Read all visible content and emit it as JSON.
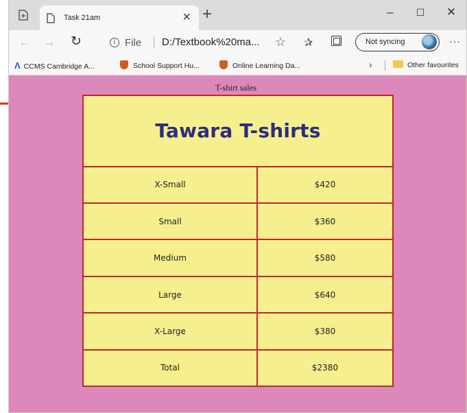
{
  "browser": {
    "tab_title": "Task 21am",
    "tab_close": "×",
    "new_tab": "+",
    "window_controls": {
      "minimize": "–",
      "maximize": "☐",
      "close": "✕"
    },
    "nav": {
      "back": "←",
      "forward": "→",
      "refresh": "↻"
    },
    "address": {
      "info": "i",
      "file_label": "File",
      "url": "D:/Textbook%20ma...",
      "favorite_star": "☆"
    },
    "favorites_icon": "✰",
    "sync_label": "Not syncing",
    "more": "···"
  },
  "favorites_bar": {
    "items": [
      {
        "label": "CCMS Cambridge A...",
        "icon": "ccms-logo-icon"
      },
      {
        "label": "School Support Hu...",
        "icon": "shield-icon"
      },
      {
        "label": "Online Learning Da...",
        "icon": "shield-icon"
      }
    ],
    "overflow": "›",
    "other": "Other favourites"
  },
  "page": {
    "caption": "T-shirt sales",
    "table_title": "Tawara T-shirts",
    "rows": [
      {
        "size": "X-Small",
        "sales": "$420"
      },
      {
        "size": "Small",
        "sales": "$360"
      },
      {
        "size": "Medium",
        "sales": "$580"
      },
      {
        "size": "Large",
        "sales": "$640"
      },
      {
        "size": "X-Large",
        "sales": "$380"
      },
      {
        "size": "Total",
        "sales": "$2380"
      }
    ]
  },
  "colors": {
    "page_background": "#dd88bb",
    "table_fill": "#f5ef8e",
    "table_border": "#c0262b",
    "title_text": "#2a2d80",
    "annotation_arrow": "#d4262b"
  }
}
